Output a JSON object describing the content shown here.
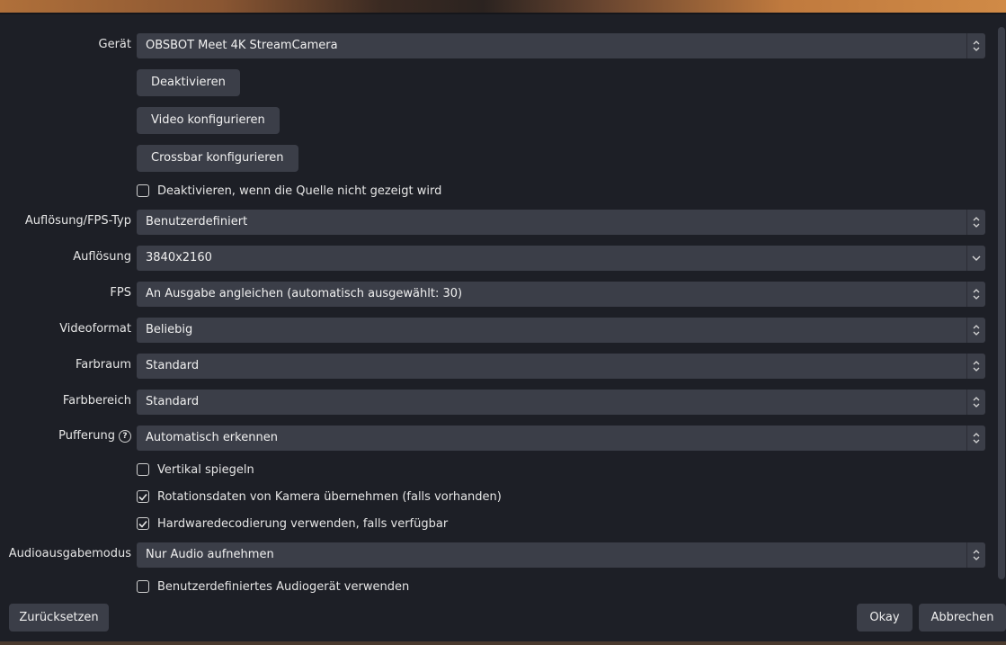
{
  "device": {
    "label": "Gerät",
    "value": "OBSBOT Meet 4K StreamCamera"
  },
  "buttons": {
    "deactivate": "Deaktivieren",
    "configure_video": "Video konfigurieren",
    "configure_crossbar": "Crossbar konfigurieren"
  },
  "checkboxes": {
    "deactivate_when_hidden": {
      "label": "Deaktivieren, wenn die Quelle nicht gezeigt wird",
      "checked": false
    },
    "flip_vertical": {
      "label": "Vertikal spiegeln",
      "checked": false
    },
    "rotation_data": {
      "label": "Rotationsdaten von Kamera übernehmen (falls vorhanden)",
      "checked": true
    },
    "hw_decoding": {
      "label": "Hardwaredecodierung verwenden, falls verfügbar",
      "checked": true
    },
    "custom_audio": {
      "label": "Benutzerdefiniertes Audiogerät verwenden",
      "checked": false
    }
  },
  "fields": {
    "res_fps_type": {
      "label": "Auflösung/FPS-Typ",
      "value": "Benutzerdefiniert"
    },
    "resolution": {
      "label": "Auflösung",
      "value": "3840x2160"
    },
    "fps": {
      "label": "FPS",
      "value": "An Ausgabe angleichen (automatisch ausgewählt: 30)"
    },
    "video_format": {
      "label": "Videoformat",
      "value": "Beliebig"
    },
    "color_space": {
      "label": "Farbraum",
      "value": "Standard"
    },
    "color_range": {
      "label": "Farbbereich",
      "value": "Standard"
    },
    "buffering": {
      "label": "Pufferung",
      "value": "Automatisch erkennen"
    },
    "audio_output_mode": {
      "label": "Audioausgabemodus",
      "value": "Nur Audio aufnehmen"
    }
  },
  "footer": {
    "reset": "Zurücksetzen",
    "ok": "Okay",
    "cancel": "Abbrechen"
  },
  "colors": {
    "background": "#1d1f26",
    "control": "#3b3e48",
    "text": "#e6e6e6"
  }
}
